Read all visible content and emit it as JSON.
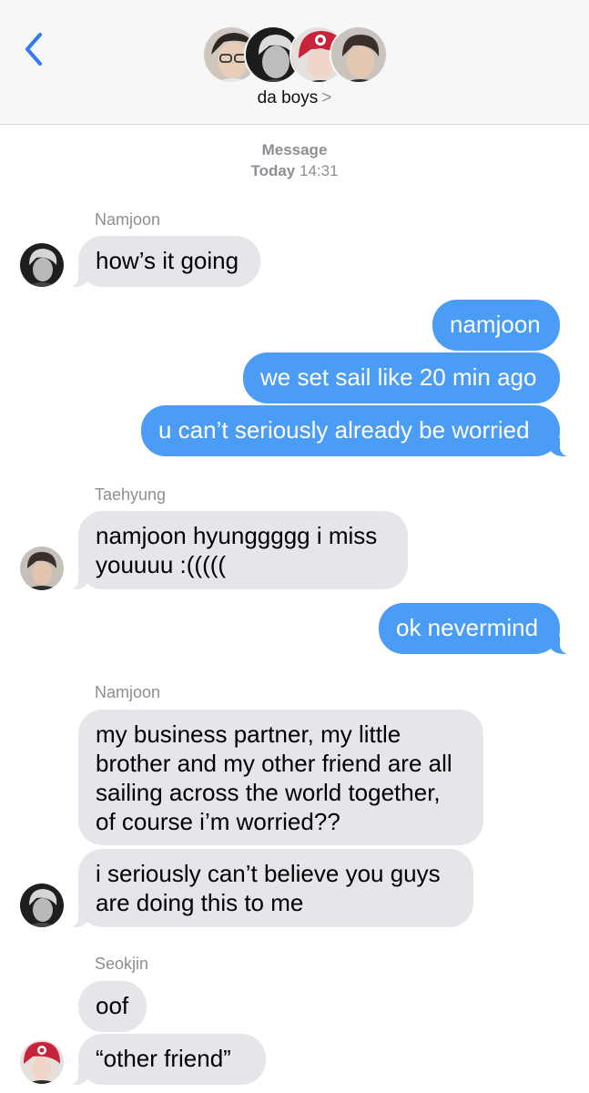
{
  "header": {
    "back_icon": "chevron-left-icon",
    "group_name": "da boys",
    "group_chevron": ">",
    "accent": "#3478f6"
  },
  "timestamp": {
    "label": "Message",
    "day": "Today",
    "time": "14:31"
  },
  "colors": {
    "incoming_bubble": "#e5e5ea",
    "outgoing_bubble": "#4a9cf5",
    "sender_name": "#8e8e93"
  },
  "messages": [
    {
      "sender": "Namjoon",
      "text": "how’s it going"
    },
    {
      "sender": "me",
      "text": "namjoon"
    },
    {
      "sender": "me",
      "text": "we set sail like 20 min ago"
    },
    {
      "sender": "me",
      "text": "u can’t seriously already be worried"
    },
    {
      "sender": "Taehyung",
      "text": "namjoon hyunggggg i miss\nyouuuu :((((("
    },
    {
      "sender": "me",
      "text": "ok nevermind"
    },
    {
      "sender": "Namjoon",
      "text": "my business partner, my little\nbrother and my other friend are all\nsailing across the world together,\nof course i’m worried??"
    },
    {
      "sender": "Namjoon",
      "text": "i seriously can’t believe you guys\nare doing this to me"
    },
    {
      "sender": "Seokjin",
      "text": "oof"
    },
    {
      "sender": "Seokjin",
      "text": "“other friend”"
    }
  ]
}
